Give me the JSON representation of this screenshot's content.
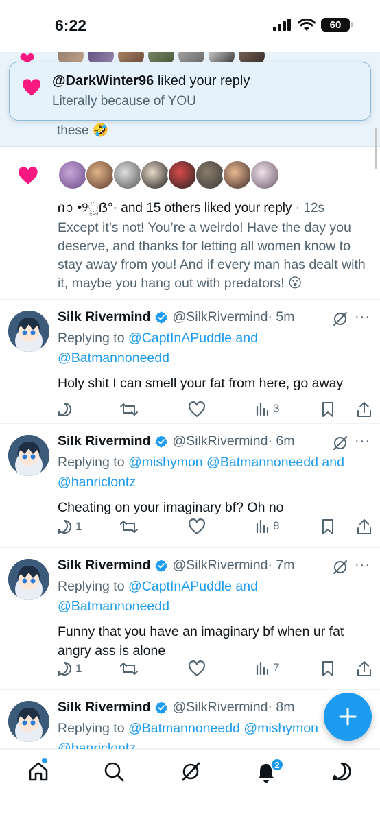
{
  "status": {
    "time": "6:22",
    "battery": "60"
  },
  "highlight": {
    "text": "these 🤣"
  },
  "toast": {
    "user": "@DarkWinter96",
    "action": " liked your reply",
    "text": "Literally because of YOU"
  },
  "like_notification": {
    "names": "በ᭵ •୨ූẞ°·",
    "summary": " and 15 others liked your reply",
    "time": " · 12s",
    "quote": "Except it’s not! You’re a weirdo! Have the day you deserve, and thanks for letting all women know to stay away from you! And if every man has dealt with it, maybe you hang out with predators! 😮"
  },
  "tweets": [
    {
      "name": "Silk Rivermind",
      "handle": "@SilkRivermind",
      "time": "· 5m",
      "replying_prefix": "Replying to ",
      "replying_mentions": "@CaptInAPuddle and @Batmannoneedd",
      "text": "Holy shit I can smell your fat from here, go away",
      "replies": "",
      "views": "3"
    },
    {
      "name": "Silk Rivermind",
      "handle": "@SilkRivermind",
      "time": "· 6m",
      "replying_prefix": "Replying to ",
      "replying_mentions": "@mishymon @Batmannoneedd and @hanriclontz",
      "text": "Cheating on your imaginary bf? Oh no",
      "replies": "1",
      "views": "8"
    },
    {
      "name": "Silk Rivermind",
      "handle": "@SilkRivermind",
      "time": "· 7m",
      "replying_prefix": "Replying to ",
      "replying_mentions": "@CaptInAPuddle and @Batmannoneedd",
      "text": "Funny that you have an imaginary bf when ur fat angry ass is alone",
      "replies": "1",
      "views": "7"
    },
    {
      "name": "Silk Rivermind",
      "handle": "@SilkRivermind",
      "time": "· 8m",
      "replying_prefix": "Replying to ",
      "replying_mentions": "@Batmannoneedd @mishymon @hanriclontz"
    }
  ],
  "nav": {
    "notifications_badge": "2"
  },
  "colors": {
    "accent": "#1d9bf0",
    "like": "#f91880",
    "muted": "#536471"
  }
}
